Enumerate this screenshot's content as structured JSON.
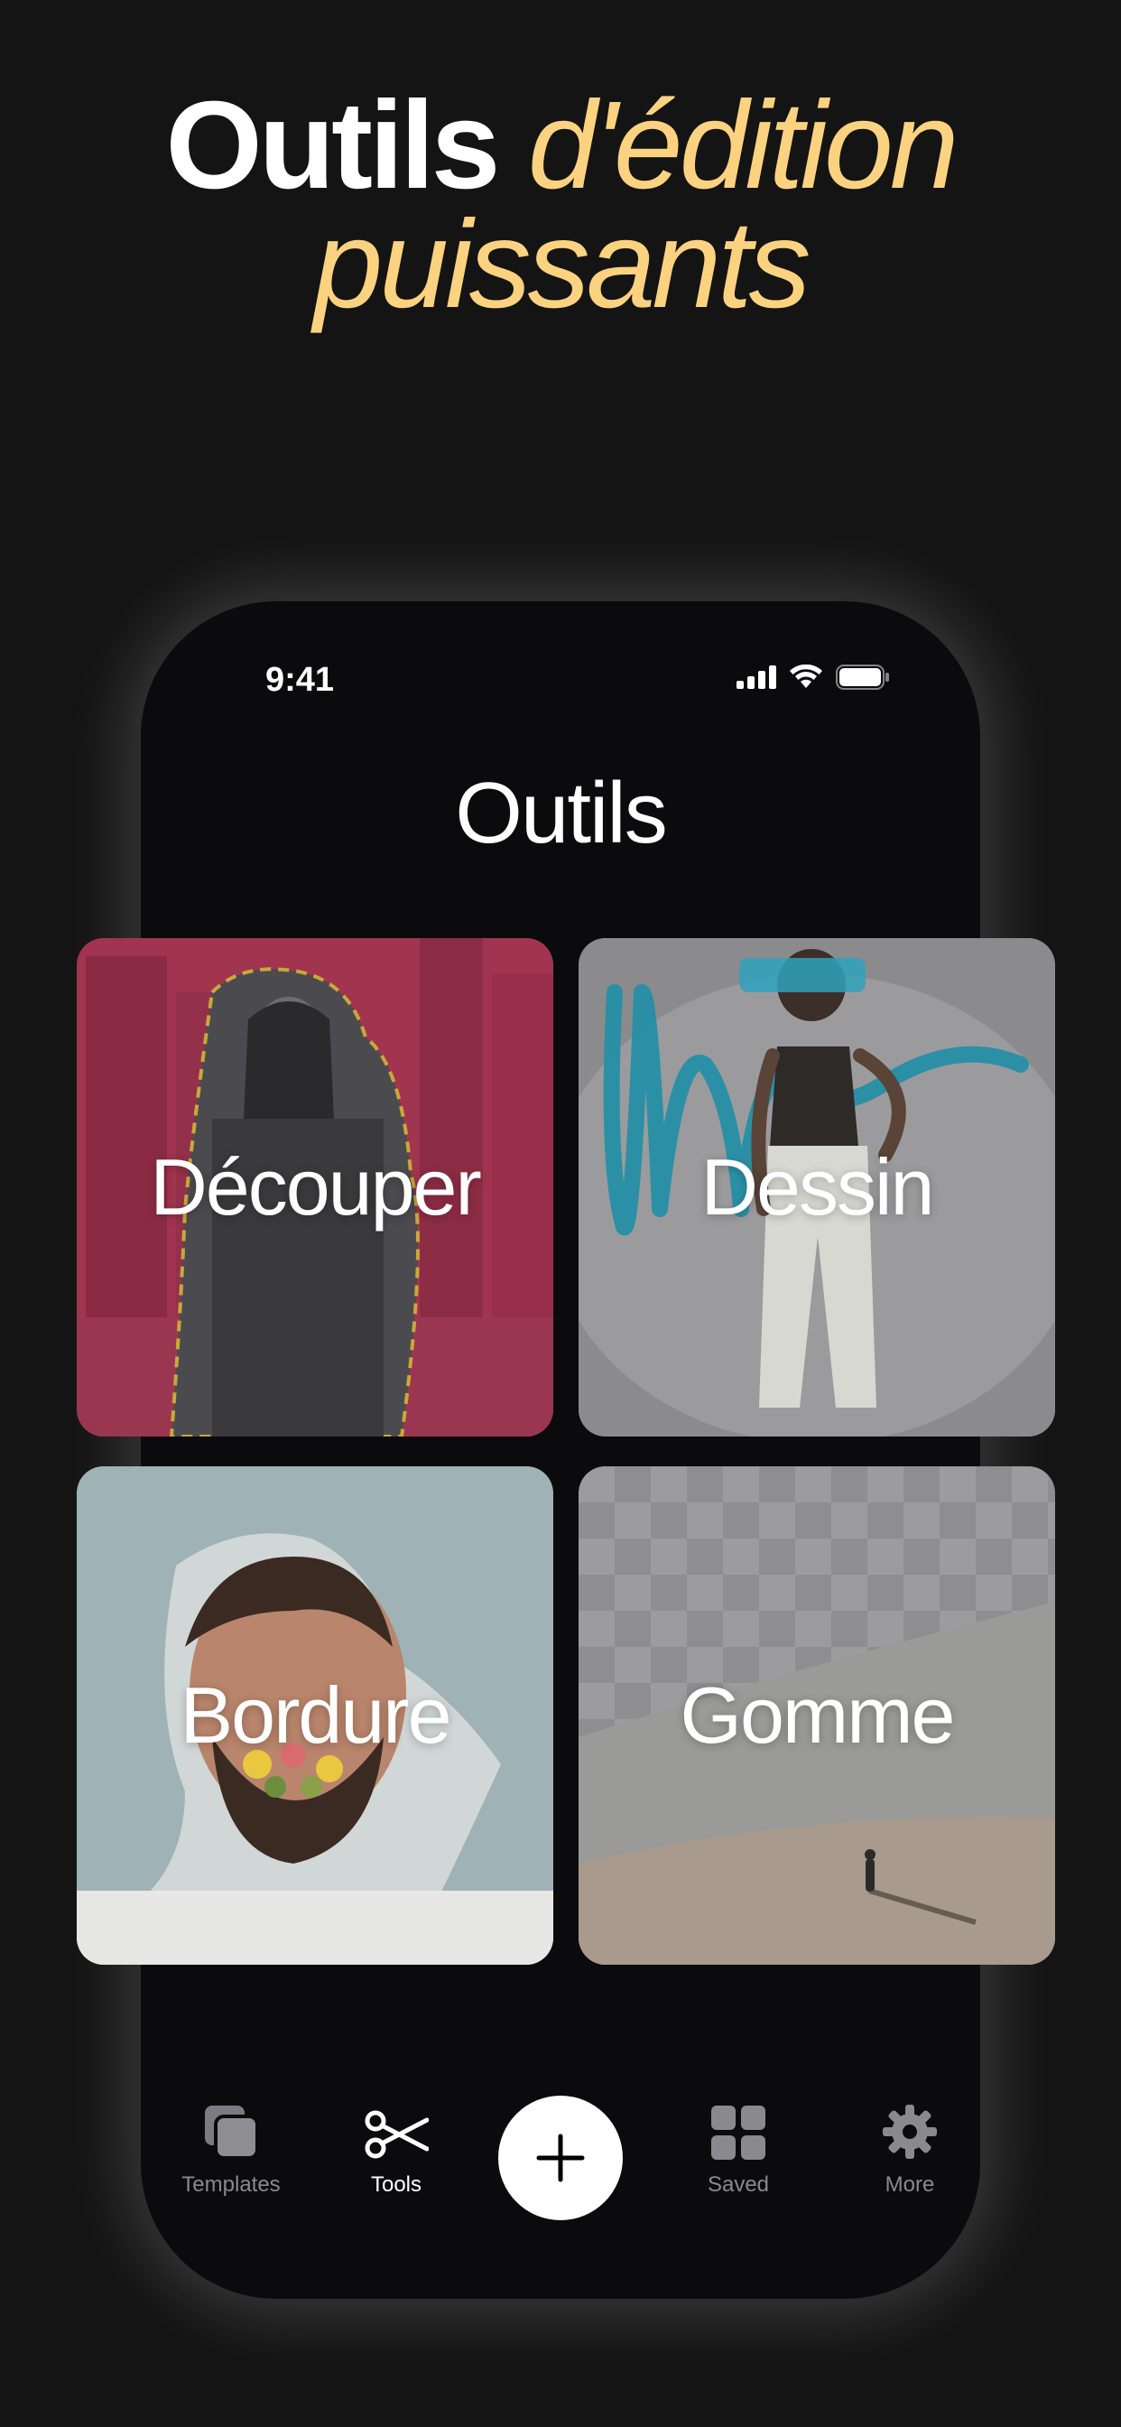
{
  "headline": {
    "white": "Outils",
    "yellow_line1": "d'édition",
    "yellow_line2": "puissants"
  },
  "status_bar": {
    "time": "9:41"
  },
  "screen": {
    "title": "Outils"
  },
  "cards": [
    {
      "label": "Découper"
    },
    {
      "label": "Dessin"
    },
    {
      "label": "Bordure"
    },
    {
      "label": "Gomme"
    }
  ],
  "tabbar": {
    "templates": "Templates",
    "tools": "Tools",
    "saved": "Saved",
    "more": "More",
    "active": "tools"
  },
  "colors": {
    "background": "#141414",
    "accent_yellow": "#fbd27f",
    "phone": "#0b0b0d",
    "card_cut": "#a1344f",
    "brush_teal": "#1f8fa6"
  }
}
